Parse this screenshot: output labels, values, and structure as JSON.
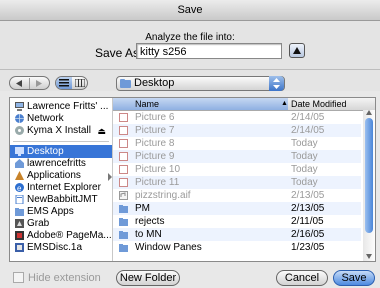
{
  "window": {
    "title": "Save"
  },
  "header": {
    "prompt": "Analyze the file into:",
    "save_as_label": "Save As:",
    "save_as_value": "kitty s256"
  },
  "toolbar": {
    "location": "Desktop"
  },
  "sidebar": {
    "devices": [
      {
        "label": "Lawrence Fritts' ...",
        "icon": "computer-icon"
      },
      {
        "label": "Network",
        "icon": "globe-icon"
      },
      {
        "label": "Kyma X Install",
        "icon": "disk-icon",
        "eject": "⏏"
      }
    ],
    "places": [
      {
        "label": "Desktop",
        "icon": "desktop-icon",
        "selected": true
      },
      {
        "label": "lawrencefritts",
        "icon": "home-icon"
      },
      {
        "label": "Applications",
        "icon": "applications-icon"
      },
      {
        "label": "Internet Explorer",
        "icon": "ie-icon"
      },
      {
        "label": "NewBabbittJMT",
        "icon": "doc-icon"
      },
      {
        "label": "EMS Apps",
        "icon": "folder-icon"
      },
      {
        "label": "Grab",
        "icon": "grab-icon"
      },
      {
        "label": "Adobe® PageMa...",
        "icon": "app-icon"
      },
      {
        "label": "EMSDisc.1a",
        "icon": "cd-icon"
      }
    ]
  },
  "filelist": {
    "columns": {
      "name": "Name",
      "sort": "▲",
      "date": "Date Modified"
    },
    "rows": [
      {
        "name": "Picture 6",
        "date": "2/14/05",
        "icon": "image-icon",
        "dim": true
      },
      {
        "name": "Picture 7",
        "date": "2/14/05",
        "icon": "image-icon",
        "dim": true
      },
      {
        "name": "Picture 8",
        "date": "Today",
        "icon": "image-icon",
        "dim": true
      },
      {
        "name": "Picture 9",
        "date": "Today",
        "icon": "image-icon",
        "dim": true
      },
      {
        "name": "Picture 10",
        "date": "Today",
        "icon": "image-icon",
        "dim": true
      },
      {
        "name": "Picture 11",
        "date": "Today",
        "icon": "image-icon",
        "dim": true
      },
      {
        "name": "pizzstring.aif",
        "date": "2/13/05",
        "icon": "audio-icon",
        "dim": true
      },
      {
        "name": "PM",
        "date": "2/13/05",
        "icon": "folder-icon",
        "dim": false
      },
      {
        "name": "rejects",
        "date": "2/11/05",
        "icon": "folder-icon",
        "dim": false
      },
      {
        "name": "to MN",
        "date": "2/16/05",
        "icon": "folder-icon",
        "dim": false
      },
      {
        "name": "Window Panes",
        "date": "1/23/05",
        "icon": "folder-icon",
        "dim": false
      }
    ]
  },
  "footer": {
    "hide_extension": "Hide extension",
    "new_folder": "New Folder",
    "cancel": "Cancel",
    "save": "Save"
  },
  "colors": {
    "selection": "#3875d7",
    "accent": "#4d8ae0"
  }
}
